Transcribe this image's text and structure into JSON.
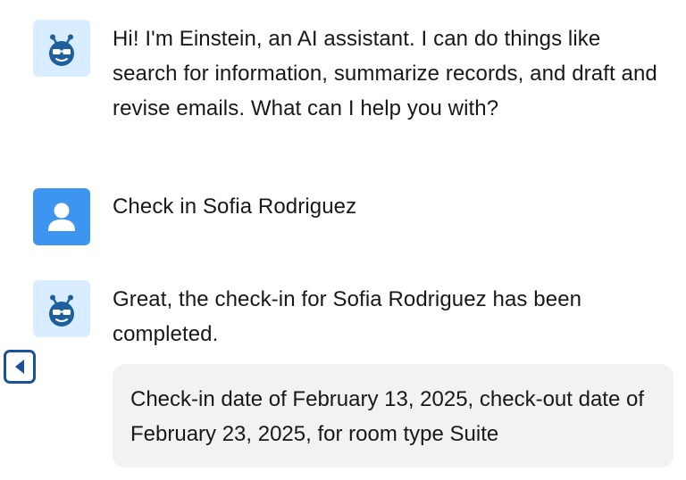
{
  "conversation": {
    "messages": [
      {
        "role": "assistant",
        "icon": "einstein-bot-icon",
        "text": "Hi! I'm Einstein, an AI assistant. I can do things like search for information, summarize records, and draft and revise emails. What can I help you with?"
      },
      {
        "role": "user",
        "icon": "user-icon",
        "text": "Check in Sofia Rodriguez"
      },
      {
        "role": "assistant",
        "icon": "einstein-bot-icon",
        "text": "Great, the check-in for Sofia Rodriguez has been completed.",
        "card": {
          "text": "Check-in date of February 13, 2025, check-out date of February 23, 2025, for room type Suite"
        }
      }
    ]
  },
  "controls": {
    "collapse_icon": "caret-left-icon"
  },
  "colors": {
    "bot_avatar_bg": "#d8edff",
    "bot_icon": "#1f5f9b",
    "user_avatar_bg": "#3e95f0",
    "card_bg": "#f2f2f2",
    "collapse_border": "#1b5297"
  }
}
